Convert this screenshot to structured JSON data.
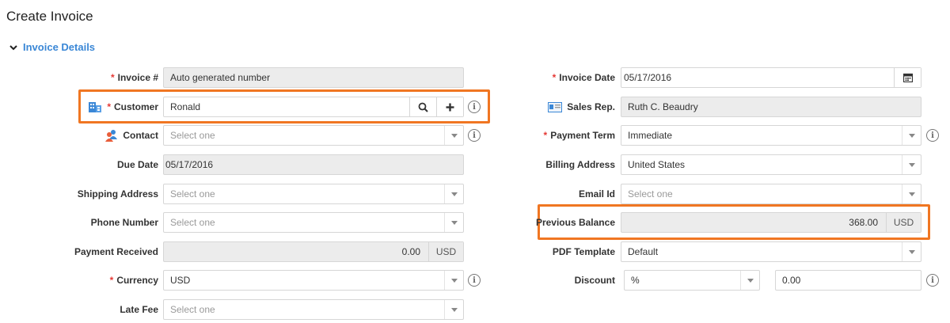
{
  "page": {
    "title": "Create Invoice"
  },
  "section": {
    "title": "Invoice Details"
  },
  "left": {
    "invoice_no": {
      "label": "Invoice #",
      "value": "Auto generated number"
    },
    "customer": {
      "label": "Customer",
      "value": "Ronald"
    },
    "contact": {
      "label": "Contact",
      "placeholder": "Select one"
    },
    "due_date": {
      "label": "Due Date",
      "value": "05/17/2016"
    },
    "shipping_address": {
      "label": "Shipping Address",
      "placeholder": "Select one"
    },
    "phone_number": {
      "label": "Phone Number",
      "placeholder": "Select one"
    },
    "payment_received": {
      "label": "Payment Received",
      "value": "0.00",
      "currency": "USD"
    },
    "currency": {
      "label": "Currency",
      "value": "USD"
    },
    "late_fee": {
      "label": "Late Fee",
      "placeholder": "Select one"
    }
  },
  "right": {
    "invoice_date": {
      "label": "Invoice Date",
      "value": "05/17/2016"
    },
    "sales_rep": {
      "label": "Sales Rep.",
      "value": "Ruth C. Beaudry"
    },
    "payment_term": {
      "label": "Payment Term",
      "value": "Immediate"
    },
    "billing_address": {
      "label": "Billing Address",
      "value": "United States"
    },
    "email_id": {
      "label": "Email Id",
      "placeholder": "Select one"
    },
    "previous_balance": {
      "label": "Previous Balance",
      "value": "368.00",
      "currency": "USD"
    },
    "pdf_template": {
      "label": "PDF Template",
      "value": "Default"
    },
    "discount": {
      "label": "Discount",
      "type": "%",
      "value": "0.00"
    }
  },
  "required_marker": "*",
  "info_glyph": "i",
  "colors": {
    "accent": "#3a87d6",
    "highlight": "#f07622",
    "required": "#e53935"
  }
}
